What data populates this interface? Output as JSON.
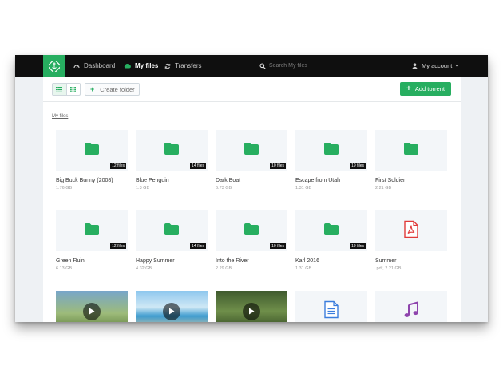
{
  "navbar": {
    "items": [
      {
        "label": "Dashboard",
        "icon": "dashboard-icon",
        "active": false
      },
      {
        "label": "My files",
        "icon": "cloud-icon",
        "active": true
      },
      {
        "label": "Transfers",
        "icon": "refresh-icon",
        "active": false
      }
    ],
    "search": {
      "placeholder": "Search My files"
    },
    "account": {
      "label": "My account"
    }
  },
  "toolbar": {
    "create_folder_label": "Create folder",
    "add_torrent_label": "Add torrent"
  },
  "breadcrumb": "My files",
  "colors": {
    "accent": "#27ae60",
    "pdf": "#e03a3a",
    "doc": "#3b7ddd",
    "music": "#8e44ad"
  },
  "files": [
    {
      "name": "Big Buck Bunny (2008)",
      "meta": "1.76 GB",
      "badge": "12 files",
      "type": "folder"
    },
    {
      "name": "Blue Penguin",
      "meta": "1.3 GB",
      "badge": "14 files",
      "type": "folder"
    },
    {
      "name": "Dark Boat",
      "meta": "6.73 GB",
      "badge": "10 files",
      "type": "folder"
    },
    {
      "name": "Escape from Utah",
      "meta": "1.31 GB",
      "badge": "19 files",
      "type": "folder"
    },
    {
      "name": "First Soldier",
      "meta": "2.21 GB",
      "badge": "",
      "type": "folder"
    },
    {
      "name": "Green Ruin",
      "meta": "6.13 GB",
      "badge": "12 files",
      "type": "folder"
    },
    {
      "name": "Happy Summer",
      "meta": "4.32 GB",
      "badge": "14 files",
      "type": "folder"
    },
    {
      "name": "Into the River",
      "meta": "2.29 GB",
      "badge": "10 files",
      "type": "folder"
    },
    {
      "name": "Karl 2016",
      "meta": "1.31 GB",
      "badge": "19 files",
      "type": "folder"
    },
    {
      "name": "Summer",
      "meta": ".pdf, 2.21 GB",
      "badge": "",
      "type": "pdf"
    },
    {
      "name": "",
      "meta": "",
      "badge": "",
      "type": "video-animals"
    },
    {
      "name": "",
      "meta": "",
      "badge": "",
      "type": "video-beach"
    },
    {
      "name": "",
      "meta": "",
      "badge": "",
      "type": "video-forest"
    },
    {
      "name": "",
      "meta": "",
      "badge": "",
      "type": "document"
    },
    {
      "name": "",
      "meta": "",
      "badge": "",
      "type": "audio"
    }
  ]
}
